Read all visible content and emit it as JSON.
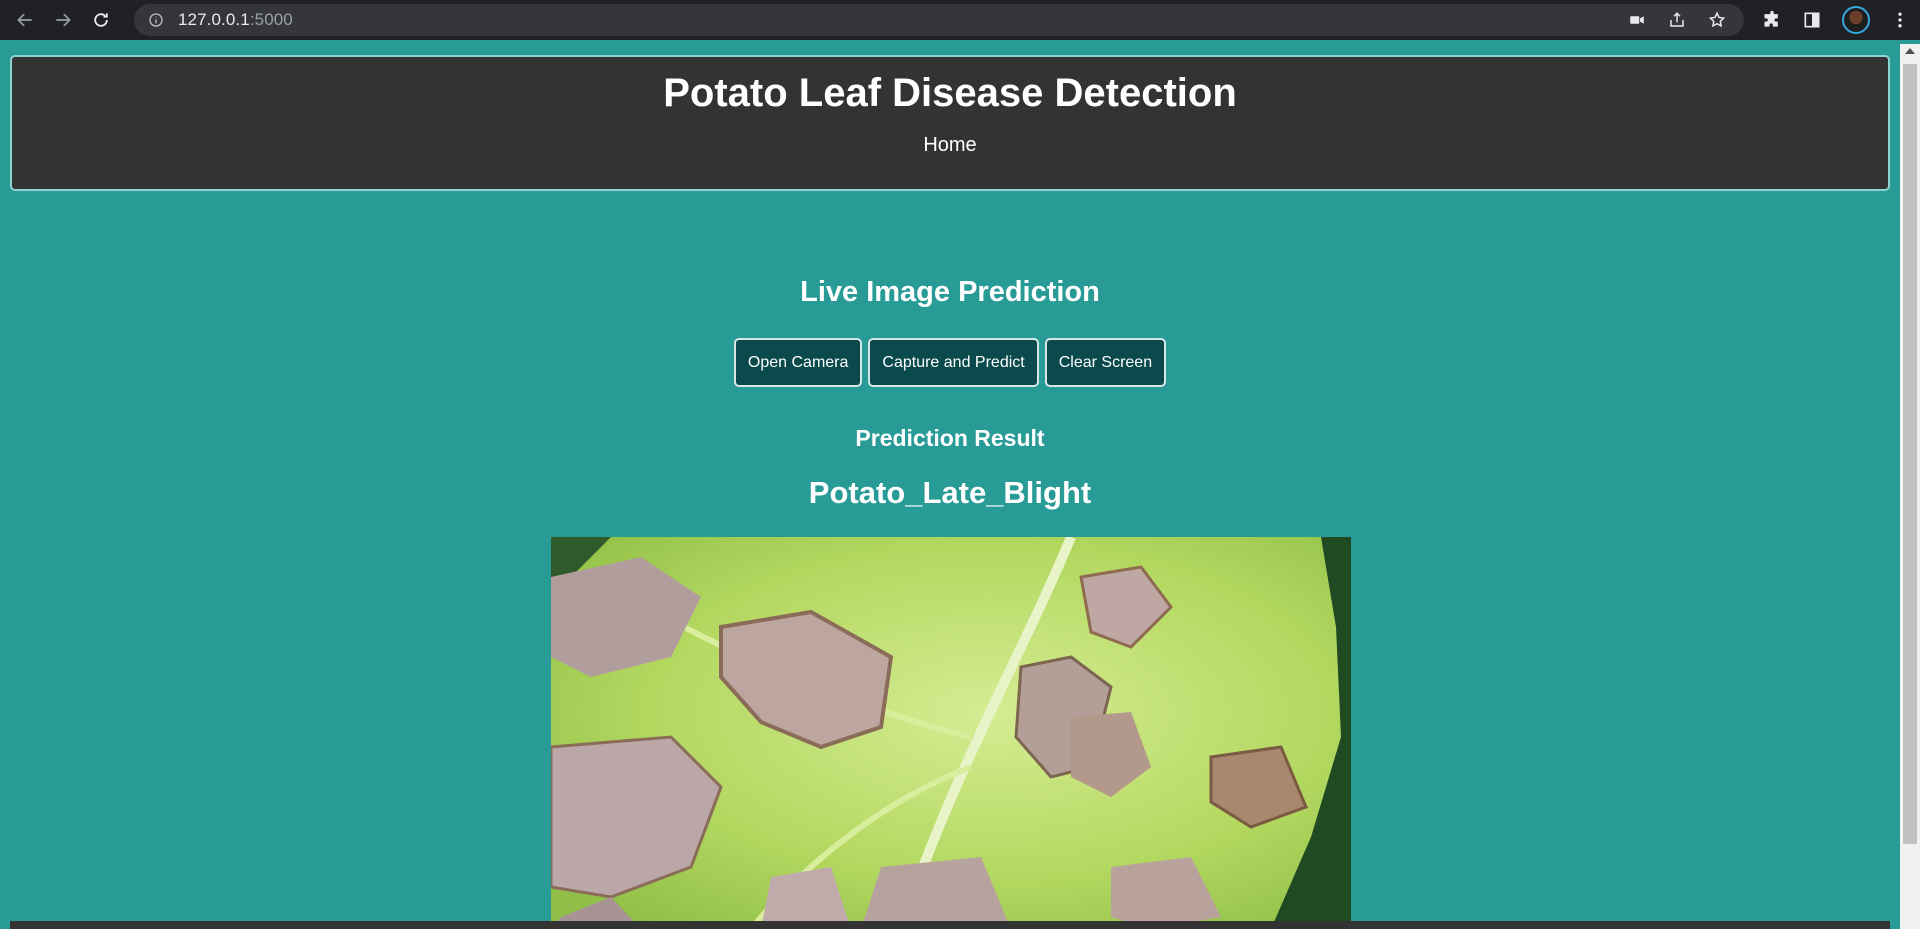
{
  "browser": {
    "url_host": "127.0.0.1",
    "url_port": ":5000"
  },
  "header": {
    "title": "Potato Leaf Disease Detection",
    "nav_home": "Home"
  },
  "live": {
    "title": "Live Image Prediction",
    "buttons": {
      "open_camera": "Open Camera",
      "capture_predict": "Capture and Predict",
      "clear_screen": "Clear Screen"
    }
  },
  "result": {
    "label": "Prediction Result",
    "value": "Potato_Late_Blight"
  },
  "colors": {
    "page_bg": "#289b97",
    "header_bg": "#333333",
    "button_bg": "#0a4a4c"
  }
}
